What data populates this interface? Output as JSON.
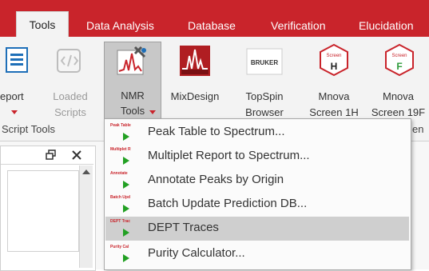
{
  "tabs": [
    "Tools",
    "Data Analysis",
    "Database",
    "Verification",
    "Elucidation"
  ],
  "ribbon": {
    "report_label": "eport",
    "loaded_scripts": [
      "Loaded",
      "Scripts"
    ],
    "nmr_tools": [
      "NMR",
      "Tools"
    ],
    "mixdesign": "MixDesign",
    "topspin": [
      "TopSpin",
      "Browser"
    ],
    "screen_1h": [
      "Mnova",
      "Screen 1H"
    ],
    "screen_19f": [
      "Mnova",
      "Screen 19F"
    ],
    "group_script_tools": "Script Tools",
    "group_tail": "en",
    "bruker_text": "BRUKER",
    "screen_badge_1": "Screen",
    "screen_badge_1_letter": "H",
    "screen_badge_2": "Screen",
    "screen_badge_2_letter": "F"
  },
  "menu": {
    "items": [
      {
        "tiny": "Peak Table",
        "label": "Peak Table to Spectrum..."
      },
      {
        "tiny": "Multiplet R",
        "label": "Multiplet Report to Spectrum..."
      },
      {
        "tiny": "Annotate",
        "label": "Annotate Peaks by Origin"
      },
      {
        "tiny": "Batch Upd",
        "label": "Batch Update Prediction DB..."
      },
      {
        "tiny": "DEPT Trac",
        "label": "DEPT Traces"
      },
      {
        "tiny": "Purity Cal",
        "label": "Purity Calculator..."
      }
    ],
    "hovered_index": 4
  },
  "colors": {
    "accent": "#c9242b",
    "play": "#22a023"
  }
}
